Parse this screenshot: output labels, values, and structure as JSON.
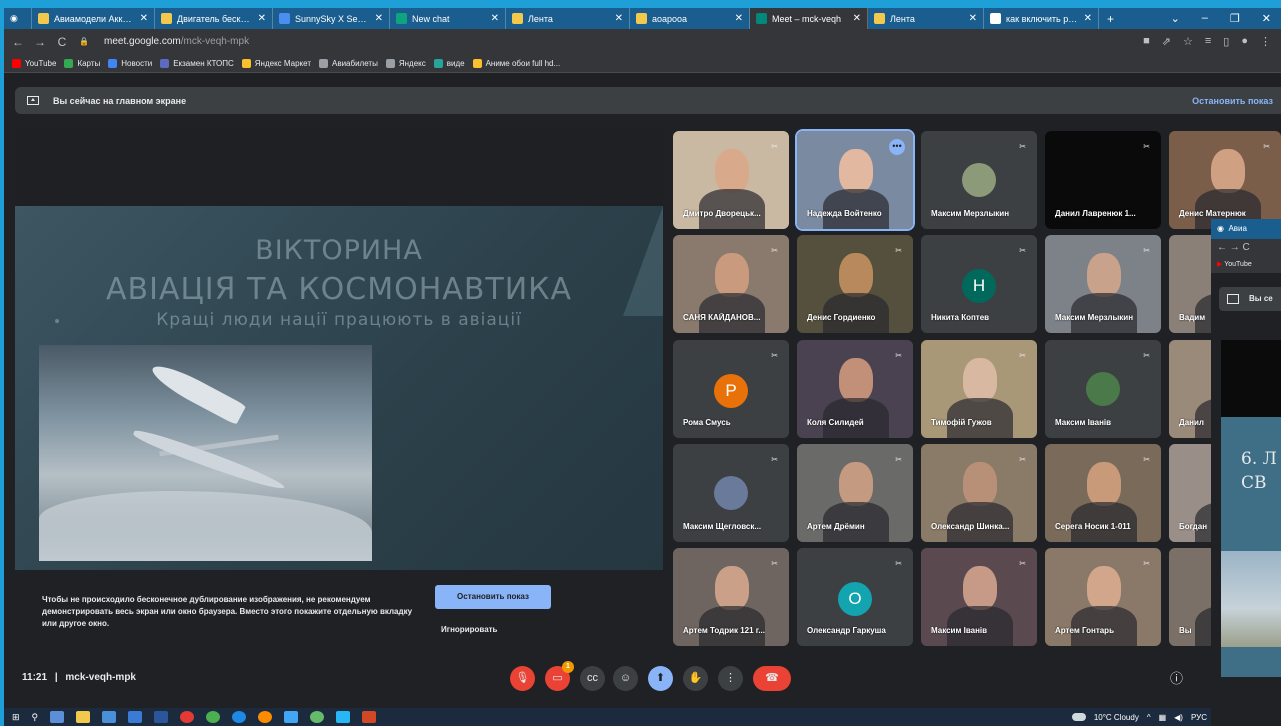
{
  "browser": {
    "tabs": [
      {
        "title": "Авиамодели Аккуму",
        "color": "#f2c94c"
      },
      {
        "title": "Двигатель бесколле",
        "color": "#f2c94c"
      },
      {
        "title": "SunnySky X Series V3",
        "color": "#4c8df2"
      },
      {
        "title": "New chat",
        "color": "#10a37f"
      },
      {
        "title": "Лента",
        "color": "#f2c94c"
      },
      {
        "title": "аоарооа",
        "color": "#f2c94c"
      },
      {
        "title": "Meet – mck-veqh",
        "color": "#00897b",
        "active": true
      },
      {
        "title": "Лента",
        "color": "#f2c94c"
      },
      {
        "title": "как включить распр",
        "color": "#ffffff"
      }
    ],
    "new_tab_symbol": "+",
    "url_host": "meet.google.com",
    "url_path": "/mck-veqh-mpk",
    "bookmarks": [
      {
        "label": "YouTube",
        "color": "#ff0000"
      },
      {
        "label": "Карты",
        "color": "#34a853"
      },
      {
        "label": "Новости",
        "color": "#4285f4"
      },
      {
        "label": "Екзамен КТОПС",
        "color": "#5c6bc0"
      },
      {
        "label": "Яндекс Маркет",
        "color": "#fbc02d"
      },
      {
        "label": "Авиабилеты",
        "color": "#9aa0a6"
      },
      {
        "label": "Яндекс",
        "color": "#9aa0a6"
      },
      {
        "label": "виде",
        "color": "#26a69a"
      },
      {
        "label": "Аниме обои full hd...",
        "color": "#fbc02d"
      }
    ]
  },
  "banner": {
    "text": "Вы сейчас на главном экране",
    "stop_link": "Остановить показ"
  },
  "slide": {
    "title1": "ВІКТОРИНА",
    "title2": "АВІАЦІЯ ТА КОСМОНАВТИКА",
    "subtitle": "Кращі люди нації працюють в авіації"
  },
  "warning": {
    "text": "Чтобы не происходило бесконечное дублирование изображения, не рекомендуем демонстрировать весь экран или окно браузера. Вместо этого покажите отдельную вкладку или другое окно.",
    "stop_button": "Остановить показ",
    "ignore": "Игнорировать"
  },
  "participants": [
    {
      "name": "Дмитро Дворецьк...",
      "kind": "video",
      "bg": "#c9b9a3",
      "face": "#d9a98c"
    },
    {
      "name": "Надежда Войтенко",
      "kind": "video",
      "bg": "#7a8aa0",
      "face": "#e2b8a0",
      "speaking": true
    },
    {
      "name": "Максим Мерзлыкин",
      "kind": "avatar",
      "bg": "#3c4043",
      "avatar": "#8d9a7a"
    },
    {
      "name": "Данил Лавренюк 1...",
      "kind": "video",
      "bg": "#0a0a0a",
      "face": ""
    },
    {
      "name": "Денис Матернюк",
      "kind": "video",
      "bg": "#7a5e4a",
      "face": "#d0a083"
    },
    {
      "name": "САНЯ КАЙДАНОВ...",
      "kind": "video",
      "bg": "#8a7a6e",
      "face": "#c99a7e"
    },
    {
      "name": "Денис Гордиенко",
      "kind": "video",
      "bg": "#55503e",
      "face": "#b8895d"
    },
    {
      "name": "Никита Коптев",
      "kind": "letter",
      "letter": "Н",
      "bg": "#3c4043",
      "avatar": "#00695c"
    },
    {
      "name": "Максим Мерзлыкин",
      "kind": "video",
      "bg": "#7c8288",
      "face": "#c8a28a"
    },
    {
      "name": "Вадим",
      "kind": "video",
      "bg": "#8a8078",
      "face": "#c8a08a"
    },
    {
      "name": "Рома Смусь",
      "kind": "letter",
      "letter": "P",
      "bg": "#3c4043",
      "avatar": "#e8710a"
    },
    {
      "name": "Коля Силидей",
      "kind": "video",
      "bg": "#4a4250",
      "face": "#c29078"
    },
    {
      "name": "Тимофій Гужов",
      "kind": "video",
      "bg": "#a89878",
      "face": "#d8b8a0"
    },
    {
      "name": "Максим Іванів",
      "kind": "avatar",
      "bg": "#3c4043",
      "avatar": "#4a7a4a"
    },
    {
      "name": "Данил",
      "kind": "video",
      "bg": "#9a8a7a",
      "face": "#c9a085"
    },
    {
      "name": "Максим Щегловск...",
      "kind": "avatar",
      "bg": "#3c4043",
      "avatar": "#6a7a9a"
    },
    {
      "name": "Артем Дрёмин",
      "kind": "video",
      "bg": "#6a6a68",
      "face": "#c49a80"
    },
    {
      "name": "Олександр Шинка...",
      "kind": "video",
      "bg": "#8a7a68",
      "face": "#b89078"
    },
    {
      "name": "Серега Носик 1-011",
      "kind": "video",
      "bg": "#7a6a5a",
      "face": "#c89a7a"
    },
    {
      "name": "Богдан",
      "kind": "video",
      "bg": "#9a8f88",
      "face": "#c9a08a"
    },
    {
      "name": "Артем Тодрик 121 г...",
      "kind": "video",
      "bg": "#6e6460",
      "face": "#caa088"
    },
    {
      "name": "Олександр Гаркуша",
      "kind": "letter",
      "letter": "О",
      "bg": "#3c4043",
      "avatar": "#12a4af"
    },
    {
      "name": "Максим Іванів",
      "kind": "video",
      "bg": "#5a4a50",
      "face": "#c69a86"
    },
    {
      "name": "Артем Гонтарь",
      "kind": "video",
      "bg": "#8a7868",
      "face": "#d2a68a"
    },
    {
      "name": "Вы",
      "kind": "video",
      "bg": "#7a7068",
      "face": "#c8a08a"
    }
  ],
  "mini_window": {
    "tab": "Авиа",
    "bookmark": "YouTube",
    "banner": "Вы се",
    "slide_text_1": "6. Л",
    "slide_text_2": "СВ"
  },
  "bottom": {
    "time": "11:21",
    "separator": "|",
    "meeting_code": "mck-veqh-mpk",
    "notification_count": "1"
  },
  "taskbar": {
    "weather": "10°C Cloudy",
    "lang": "РУС"
  }
}
